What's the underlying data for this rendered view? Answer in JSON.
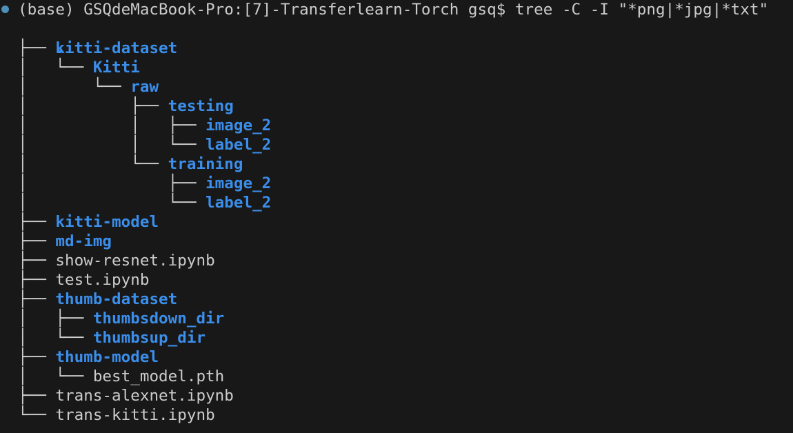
{
  "terminal": {
    "prompt": "(base) GSQdeMacBook-Pro:[7]-Transferlearn-Torch gsq$ ",
    "command": "tree -C -I \"*png|*jpg|*txt\"",
    "status_color": "#4d90b8",
    "dir_color": "#3b8eea",
    "text_color": "#cccccc",
    "background": "#181818"
  },
  "tree": {
    "root": ".",
    "entries": [
      {
        "prefix": "├── ",
        "name": "kitti-dataset",
        "type": "dir"
      },
      {
        "prefix": "│   └── ",
        "name": "Kitti",
        "type": "dir"
      },
      {
        "prefix": "│       └── ",
        "name": "raw",
        "type": "dir"
      },
      {
        "prefix": "│           ├── ",
        "name": "testing",
        "type": "dir"
      },
      {
        "prefix": "│           │   ├── ",
        "name": "image_2",
        "type": "dir"
      },
      {
        "prefix": "│           │   └── ",
        "name": "label_2",
        "type": "dir"
      },
      {
        "prefix": "│           └── ",
        "name": "training",
        "type": "dir"
      },
      {
        "prefix": "│               ├── ",
        "name": "image_2",
        "type": "dir"
      },
      {
        "prefix": "│               └── ",
        "name": "label_2",
        "type": "dir"
      },
      {
        "prefix": "├── ",
        "name": "kitti-model",
        "type": "dir"
      },
      {
        "prefix": "├── ",
        "name": "md-img",
        "type": "dir"
      },
      {
        "prefix": "├── ",
        "name": "show-resnet.ipynb",
        "type": "file"
      },
      {
        "prefix": "├── ",
        "name": "test.ipynb",
        "type": "file"
      },
      {
        "prefix": "├── ",
        "name": "thumb-dataset",
        "type": "dir"
      },
      {
        "prefix": "│   ├── ",
        "name": "thumbsdown_dir",
        "type": "dir"
      },
      {
        "prefix": "│   └── ",
        "name": "thumbsup_dir",
        "type": "dir"
      },
      {
        "prefix": "├── ",
        "name": "thumb-model",
        "type": "dir"
      },
      {
        "prefix": "│   └── ",
        "name": "best_model.pth",
        "type": "file"
      },
      {
        "prefix": "├── ",
        "name": "trans-alexnet.ipynb",
        "type": "file"
      },
      {
        "prefix": "└── ",
        "name": "trans-kitti.ipynb",
        "type": "file"
      }
    ]
  }
}
